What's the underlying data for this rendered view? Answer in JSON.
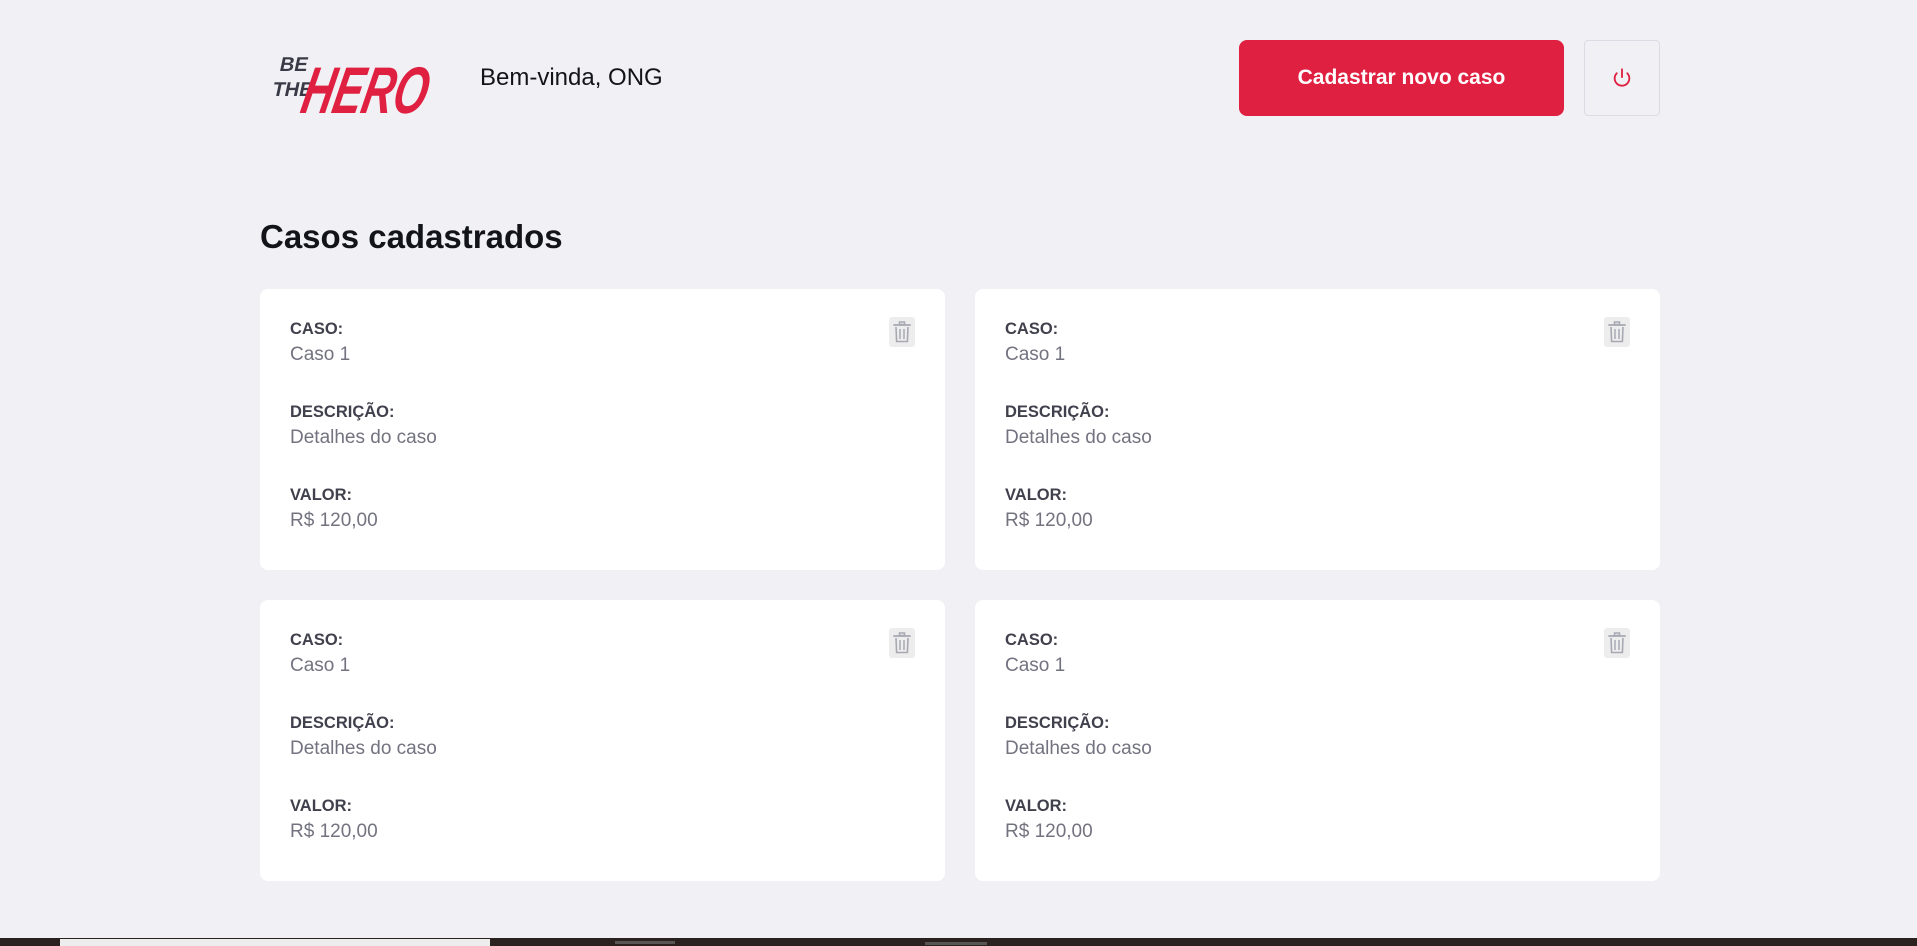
{
  "brand": {
    "logo_text_small": [
      "BE",
      "THE"
    ],
    "logo_text_big": "HERO",
    "accent_color": "#E02041"
  },
  "header": {
    "welcome": "Bem-vinda, ONG",
    "new_case_label": "Cadastrar novo caso",
    "logout_icon": "power-icon"
  },
  "main": {
    "title": "Casos cadastrados",
    "labels": {
      "case": "CASO:",
      "description": "DESCRIÇÃO:",
      "value": "VALOR:"
    },
    "delete_icon": "trash-icon",
    "cases": [
      {
        "title": "Caso 1",
        "description": "Detalhes do caso",
        "value": "R$ 120,00"
      },
      {
        "title": "Caso 1",
        "description": "Detalhes do caso",
        "value": "R$ 120,00"
      },
      {
        "title": "Caso 1",
        "description": "Detalhes do caso",
        "value": "R$ 120,00"
      },
      {
        "title": "Caso 1",
        "description": "Detalhes do caso",
        "value": "R$ 120,00"
      }
    ]
  }
}
